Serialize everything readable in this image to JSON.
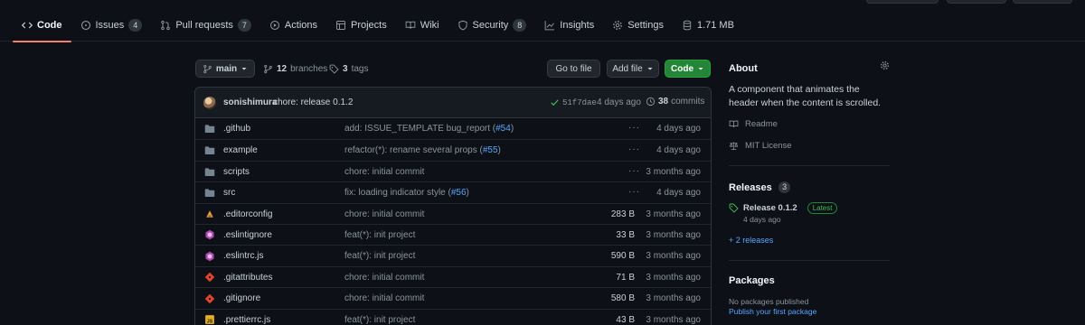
{
  "colors": {
    "background": "#0d1117",
    "accent_underline": "#f78166",
    "primary_button": "#238636",
    "link": "#58a6ff",
    "success": "#3fb950"
  },
  "nav": {
    "tabs": [
      {
        "label": "Code",
        "icon": "code-icon",
        "active": true
      },
      {
        "label": "Issues",
        "icon": "issue-opened-icon",
        "count": "4"
      },
      {
        "label": "Pull requests",
        "icon": "git-pull-request-icon",
        "count": "7"
      },
      {
        "label": "Actions",
        "icon": "play-icon"
      },
      {
        "label": "Projects",
        "icon": "table-icon"
      },
      {
        "label": "Wiki",
        "icon": "book-icon"
      },
      {
        "label": "Security",
        "icon": "shield-icon",
        "count": "8"
      },
      {
        "label": "Insights",
        "icon": "graph-icon"
      },
      {
        "label": "Settings",
        "icon": "gear-icon"
      },
      {
        "label": "1.71 MB",
        "icon": "database-icon"
      }
    ]
  },
  "toolbar": {
    "branch": "main",
    "branches_count": "12",
    "branches_label": "branches",
    "tags_count": "3",
    "tags_label": "tags",
    "go_to_file": "Go to file",
    "add_file": "Add file",
    "code": "Code"
  },
  "commit": {
    "author": "sonishimura",
    "message": "chore: release 0.1.2",
    "sha": "51f7dae",
    "time": "4 days ago",
    "count": "38",
    "count_label": "commits"
  },
  "files": [
    {
      "type": "dir",
      "icon": "folder-icon",
      "name": ".github",
      "msg": "add: ISSUE_TEMPLATE bug_report (",
      "link": "#54",
      "msg_end": ")",
      "size": "",
      "dots": "···",
      "time": "4 days ago"
    },
    {
      "type": "dir",
      "icon": "folder-icon",
      "name": "example",
      "msg": "refactor(*): rename several props (",
      "link": "#55",
      "msg_end": ")",
      "size": "",
      "dots": "···",
      "time": "4 days ago"
    },
    {
      "type": "dir",
      "icon": "folder-icon",
      "name": "scripts",
      "msg": "chore: initial commit",
      "link": "",
      "msg_end": "",
      "size": "",
      "dots": "···",
      "time": "3 months ago"
    },
    {
      "type": "dir",
      "icon": "folder-icon",
      "name": "src",
      "msg": "fix: loading indicator style (",
      "link": "#56",
      "msg_end": ")",
      "size": "",
      "dots": "···",
      "time": "4 days ago"
    },
    {
      "type": "file",
      "icon": "editorconfig-icon",
      "name": ".editorconfig",
      "msg": "chore: initial commit",
      "link": "",
      "msg_end": "",
      "size": "283 B",
      "dots": "",
      "time": "3 months ago"
    },
    {
      "type": "file",
      "icon": "eslint-icon",
      "name": ".eslintignore",
      "msg": "feat(*): init project",
      "link": "",
      "msg_end": "",
      "size": "33 B",
      "dots": "",
      "time": "3 months ago"
    },
    {
      "type": "file",
      "icon": "eslint-icon",
      "name": ".eslintrc.js",
      "msg": "feat(*): init project",
      "link": "",
      "msg_end": "",
      "size": "590 B",
      "dots": "",
      "time": "3 months ago"
    },
    {
      "type": "file",
      "icon": "git-icon",
      "name": ".gitattributes",
      "msg": "chore: initial commit",
      "link": "",
      "msg_end": "",
      "size": "71 B",
      "dots": "",
      "time": "3 months ago"
    },
    {
      "type": "file",
      "icon": "git-icon",
      "name": ".gitignore",
      "msg": "chore: initial commit",
      "link": "",
      "msg_end": "",
      "size": "580 B",
      "dots": "",
      "time": "3 months ago"
    },
    {
      "type": "file",
      "icon": "javascript-icon",
      "name": ".prettierrc.js",
      "msg": "feat(*): init project",
      "link": "",
      "msg_end": "",
      "size": "43 B",
      "dots": "",
      "time": "3 months ago"
    }
  ],
  "sidebar": {
    "about_title": "About",
    "description": "A component that animates the header when the content is scrolled.",
    "readme": "Readme",
    "license": "MIT License",
    "releases_title": "Releases",
    "releases_count": "3",
    "release_name": "Release 0.1.2",
    "latest_label": "Latest",
    "release_date": "4 days ago",
    "more_releases": "+ 2 releases",
    "packages_title": "Packages",
    "no_packages": "No packages published",
    "publish_link": "Publish your first package"
  }
}
